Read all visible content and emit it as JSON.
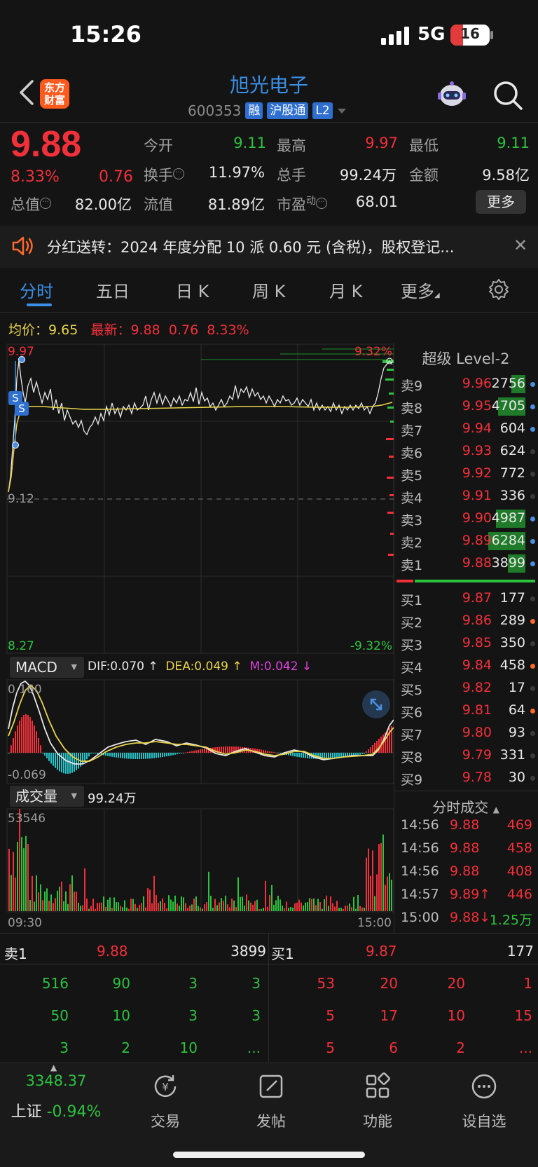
{
  "status": {
    "time": "15:26",
    "network": "5G",
    "battery": "16"
  },
  "header": {
    "logo_line1": "东方",
    "logo_line2": "财富",
    "title": "旭光电子",
    "code": "600353",
    "tags": [
      "融",
      "沪股通",
      "L2"
    ]
  },
  "quote": {
    "price": "9.88",
    "change_pct": "8.33%",
    "change": "0.76",
    "open_label": "今开",
    "open": "9.11",
    "high_label": "最高",
    "high": "9.97",
    "low_label": "最低",
    "low": "9.11",
    "turnover_label": "换手",
    "turnover": "11.97%",
    "volume_label": "总手",
    "volume": "99.24万",
    "amount_label": "金额",
    "amount": "9.58亿",
    "mcap_label": "总值",
    "mcap": "82.00亿",
    "float_label": "流值",
    "float": "81.89亿",
    "pe_label": "市盈",
    "pe_sup": "动",
    "pe": "68.01",
    "more": "更多"
  },
  "notice": {
    "text": "分红送转：2024 年度分配 10 派 0.60 元 (含税)，股权登记..."
  },
  "tabs": [
    "分时",
    "五日",
    "日 K",
    "周 K",
    "月 K",
    "更多"
  ],
  "chart": {
    "avg_label": "均价：",
    "avg": "9.65",
    "last_label": "最新：",
    "last": "9.88",
    "last_chg": "0.76",
    "last_pct": "8.33%",
    "y_top": "9.97",
    "y_pct_top": "9.32%",
    "y_mid": "9.12",
    "y_bottom": "8.27",
    "y_pct_bottom": "-9.32%",
    "macd_label": "MACD",
    "dif": "DIF:0.070 ↑",
    "dea": "DEA:0.049 ↑",
    "m": "M:0.042 ↓",
    "macd_top": "0.160",
    "macd_bottom": "-0.069",
    "vol_label": "成交量",
    "vol_total": "99.24万",
    "vol_max": "53546",
    "time_start": "09:30",
    "time_end": "15:00",
    "marker": "S"
  },
  "level2": {
    "title": "超级 Level-2",
    "asks": [
      {
        "label": "卖9",
        "price": "9.96",
        "vol": "2756",
        "bar": 0.35,
        "dot": "#4a90e2"
      },
      {
        "label": "卖8",
        "price": "9.95",
        "vol": "4705",
        "bar": 0.7,
        "dot": "#4a90e2"
      },
      {
        "label": "卖7",
        "price": "9.94",
        "vol": "604",
        "bar": 0,
        "dot": "#4a90e2"
      },
      {
        "label": "卖6",
        "price": "9.93",
        "vol": "624",
        "bar": 0,
        "dot": "#3a3a3a"
      },
      {
        "label": "卖5",
        "price": "9.92",
        "vol": "772",
        "bar": 0,
        "dot": "#3a3a3a"
      },
      {
        "label": "卖4",
        "price": "9.91",
        "vol": "336",
        "bar": 0,
        "dot": "#3a3a3a"
      },
      {
        "label": "卖3",
        "price": "9.90",
        "vol": "4987",
        "bar": 0.75,
        "dot": "#4a90e2"
      },
      {
        "label": "卖2",
        "price": "9.89",
        "vol": "6284",
        "bar": 0.95,
        "dot": "#4a90e2"
      },
      {
        "label": "卖1",
        "price": "9.88",
        "vol": "3899",
        "bar": 0.45,
        "dot": "#4a90e2"
      }
    ],
    "bids": [
      {
        "label": "买1",
        "price": "9.87",
        "vol": "177",
        "dot": "#3a3a3a"
      },
      {
        "label": "买2",
        "price": "9.86",
        "vol": "289",
        "dot": "#ff6a2a"
      },
      {
        "label": "买3",
        "price": "9.85",
        "vol": "350",
        "dot": "#3a3a3a"
      },
      {
        "label": "买4",
        "price": "9.84",
        "vol": "458",
        "dot": "#ff6a2a"
      },
      {
        "label": "买5",
        "price": "9.82",
        "vol": "17",
        "dot": "#3a3a3a"
      },
      {
        "label": "买6",
        "price": "9.81",
        "vol": "64",
        "dot": "#ff6a2a"
      },
      {
        "label": "买7",
        "price": "9.80",
        "vol": "93",
        "dot": "#3a3a3a"
      },
      {
        "label": "买8",
        "price": "9.79",
        "vol": "331",
        "dot": "#3a3a3a"
      },
      {
        "label": "买9",
        "price": "9.78",
        "vol": "30",
        "dot": "#3a3a3a"
      }
    ],
    "ticks_title": "分时成交",
    "ticks": [
      {
        "time": "14:56",
        "price": "9.88",
        "vol": "469",
        "vcolor": "red"
      },
      {
        "time": "14:56",
        "price": "9.88",
        "vol": "458",
        "vcolor": "red"
      },
      {
        "time": "14:56",
        "price": "9.88",
        "vol": "408",
        "vcolor": "red"
      },
      {
        "time": "14:57",
        "price": "9.89↑",
        "vol": "446",
        "vcolor": "red"
      },
      {
        "time": "15:00",
        "price": "9.88↓",
        "vol": "1.25万",
        "vcolor": "green"
      }
    ]
  },
  "queue": {
    "ask_label": "卖1",
    "ask_price": "9.88",
    "ask_vol": "3899",
    "bid_label": "买1",
    "bid_price": "9.87",
    "bid_vol": "177",
    "ask_rows": [
      [
        "516",
        "90",
        "3",
        "3"
      ],
      [
        "50",
        "10",
        "3",
        "3"
      ],
      [
        "3",
        "2",
        "10",
        "..."
      ]
    ],
    "bid_rows": [
      [
        "53",
        "20",
        "20",
        "1"
      ],
      [
        "5",
        "17",
        "10",
        "15"
      ],
      [
        "5",
        "6",
        "2",
        "..."
      ]
    ]
  },
  "nav": {
    "index_value": "3348.37",
    "index_name": "上证",
    "index_pct": "-0.94%",
    "trade": "交易",
    "post": "发帖",
    "func": "功能",
    "watch": "设自选"
  }
}
